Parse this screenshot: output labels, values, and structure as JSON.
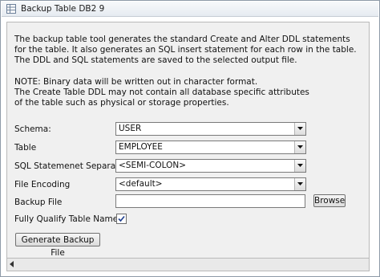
{
  "window": {
    "title": "Backup Table DB2 9",
    "icon": "table-icon"
  },
  "description": {
    "lines": [
      "The backup table tool generates the standard Create and Alter DDL statements",
      "for the table. It also generates an SQL insert statement for each row in the table.",
      "The DDL and SQL statements are saved to the selected output file."
    ],
    "note_lines": [
      "NOTE: Binary data will be written out in character format.",
      "The Create Table DDL may not contain all database specific attributes",
      "of the table such as physical or storage properties."
    ]
  },
  "form": {
    "schema": {
      "label": "Schema:",
      "value": "USER"
    },
    "table": {
      "label": "Table",
      "value": "EMPLOYEE"
    },
    "separator": {
      "label": "SQL Statemenet Separator",
      "value": "<SEMI-COLON>"
    },
    "encoding": {
      "label": "File Encoding",
      "value": "<default>"
    },
    "backup_file": {
      "label": "Backup File",
      "value": "",
      "browse_label": "Browse"
    },
    "qualify": {
      "label": "Fully Qualify Table Name",
      "checked": true
    },
    "generate_label": "Generate Backup File"
  },
  "icons": {
    "dropdown": "chevron-down-icon",
    "checkbox": "check-icon",
    "scroll_left": "scroll-left-arrow-icon"
  }
}
